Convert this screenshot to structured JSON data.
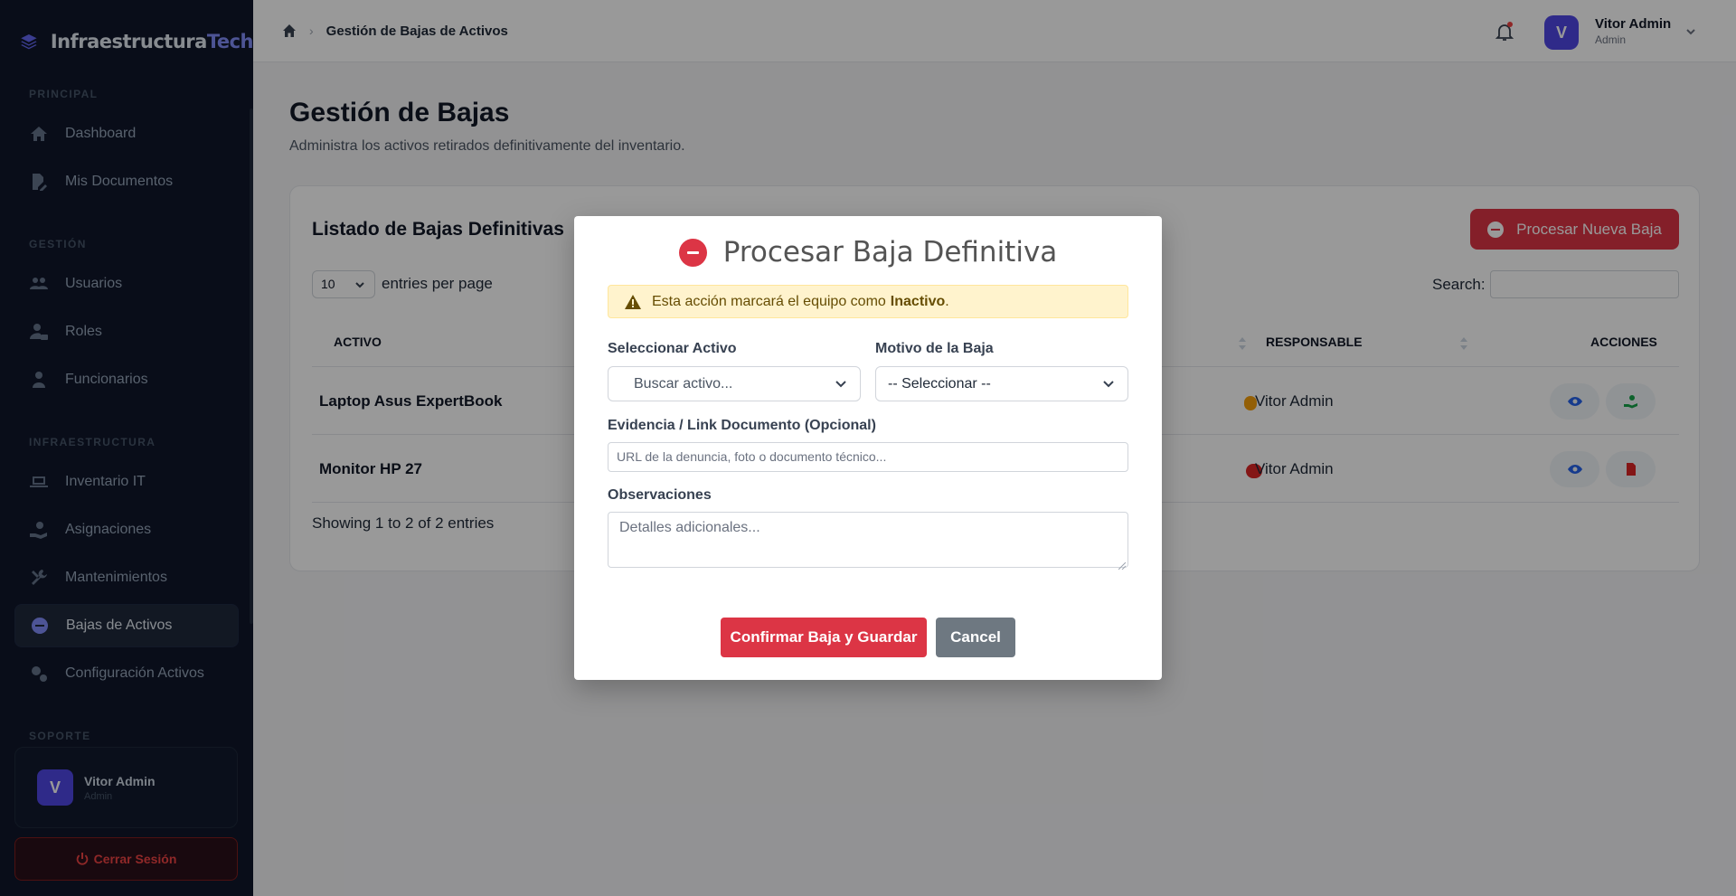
{
  "brand": {
    "name_main": "Infraestructura",
    "name_accent": "Tech"
  },
  "sidebar": {
    "sections": [
      {
        "title": "PRINCIPAL",
        "items": [
          {
            "label": "Dashboard",
            "icon": "home-icon"
          },
          {
            "label": "Mis Documentos",
            "icon": "file-pen-icon"
          }
        ]
      },
      {
        "title": "GESTIÓN",
        "items": [
          {
            "label": "Usuarios",
            "icon": "users-icon"
          },
          {
            "label": "Roles",
            "icon": "user-lock-icon"
          },
          {
            "label": "Funcionarios",
            "icon": "user-icon"
          }
        ]
      },
      {
        "title": "INFRAESTRUCTURA",
        "items": [
          {
            "label": "Inventario IT",
            "icon": "laptop-icon"
          },
          {
            "label": "Asignaciones",
            "icon": "hand-user-icon"
          },
          {
            "label": "Mantenimientos",
            "icon": "tools-icon"
          },
          {
            "label": "Bajas de Activos",
            "icon": "minus-circle-icon",
            "active": true
          },
          {
            "label": "Configuración Activos",
            "icon": "cogs-icon"
          }
        ]
      },
      {
        "title": "SOPORTE",
        "items": []
      }
    ],
    "user": {
      "initial": "V",
      "name": "Vitor Admin",
      "role": "Admin"
    },
    "logout_label": "Cerrar Sesión"
  },
  "topbar": {
    "breadcrumb": "Gestión de Bajas de Activos",
    "user": {
      "initial": "V",
      "name": "Vitor Admin",
      "role": "Admin"
    }
  },
  "page": {
    "title": "Gestión de Bajas",
    "subtitle": "Administra los activos retirados definitivamente del inventario."
  },
  "card": {
    "title": "Listado de Bajas Definitivas",
    "new_button": "Procesar Nueva Baja",
    "page_length": "10",
    "entries_label": "entries per page",
    "search_label": "Search:",
    "columns": {
      "activo": "ACTIVO",
      "responsable": "RESPONSABLE",
      "acciones": "ACCIONES"
    },
    "rows": [
      {
        "activo": "Laptop Asus ExpertBook",
        "responsable": "Vitor Admin"
      },
      {
        "activo": "Monitor HP 27",
        "responsable": "Vitor Admin"
      }
    ],
    "footer": "Showing 1 to 2 of 2 entries"
  },
  "modal": {
    "title": "Procesar Baja Definitiva",
    "alert_text": "Esta acción marcará el equipo como",
    "alert_bold": "Inactivo",
    "alert_end": ".",
    "activo_label": "Seleccionar Activo",
    "activo_placeholder": "Buscar activo...",
    "motivo_label": "Motivo de la Baja",
    "motivo_value": "-- Seleccionar --",
    "evidencia_label": "Evidencia / Link Documento (Opcional)",
    "evidencia_placeholder": "URL de la denuncia, foto o documento técnico...",
    "obs_label": "Observaciones",
    "obs_placeholder": "Detalles adicionales...",
    "confirm_label": "Confirmar Baja y Guardar",
    "cancel_label": "Cancel"
  },
  "colors": {
    "danger": "#dc3545",
    "accent": "#4f46e5",
    "sidebar_bg": "#0f172a"
  }
}
